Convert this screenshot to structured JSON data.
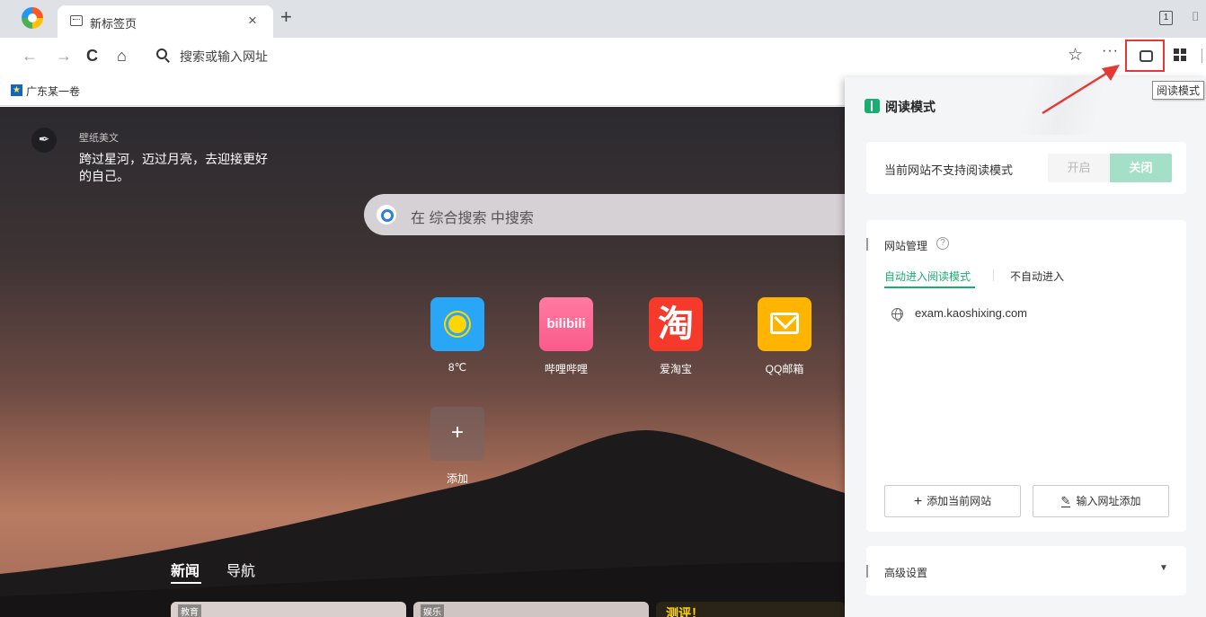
{
  "tab": {
    "title": "新标签页",
    "close": "×",
    "new": "+",
    "counter": "1"
  },
  "address_bar": {
    "placeholder": "搜索或输入网址"
  },
  "toolbar": {
    "more": "···"
  },
  "bookmarks": [
    {
      "label": "广东某一卷"
    }
  ],
  "tooltip": "阅读模式",
  "wallpaper_quote": {
    "source": "壁纸美文",
    "text": "跨过星河，迈过月亮，去迎接更好的自己。"
  },
  "search": {
    "placeholder": "在 综合搜索 中搜索"
  },
  "tiles": [
    {
      "label": "8℃",
      "icon": "weather-sun-icon"
    },
    {
      "label": "哔哩哔哩",
      "icon": "bilibili-icon",
      "glyph": "bilibili"
    },
    {
      "label": "爱淘宝",
      "icon": "taobao-icon",
      "glyph": "淘"
    },
    {
      "label": "QQ邮箱",
      "icon": "mail-icon"
    },
    {
      "label": "添加",
      "icon": "add-icon",
      "glyph": "+"
    }
  ],
  "news_tabs": [
    {
      "label": "新闻",
      "active": true
    },
    {
      "label": "导航",
      "active": false
    }
  ],
  "news_cards": [
    {
      "tag": "教育"
    },
    {
      "tag": "娱乐"
    },
    {
      "tag": "测评！"
    }
  ],
  "reader_panel": {
    "title": "阅读模式",
    "support_text": "当前网站不支持阅读模式",
    "toggle_on": "开启",
    "toggle_off": "关闭",
    "site_management": "网站管理",
    "help": "?",
    "tabs": [
      "自动进入阅读模式",
      "不自动进入"
    ],
    "sites": [
      "exam.kaoshixing.com"
    ],
    "add_current": "添加当前网站",
    "add_by_url": "输入网址添加",
    "advanced": "高级设置",
    "caret": "▼"
  },
  "colors": {
    "accent_green": "#1aad70",
    "annotation_red": "#e53935"
  }
}
